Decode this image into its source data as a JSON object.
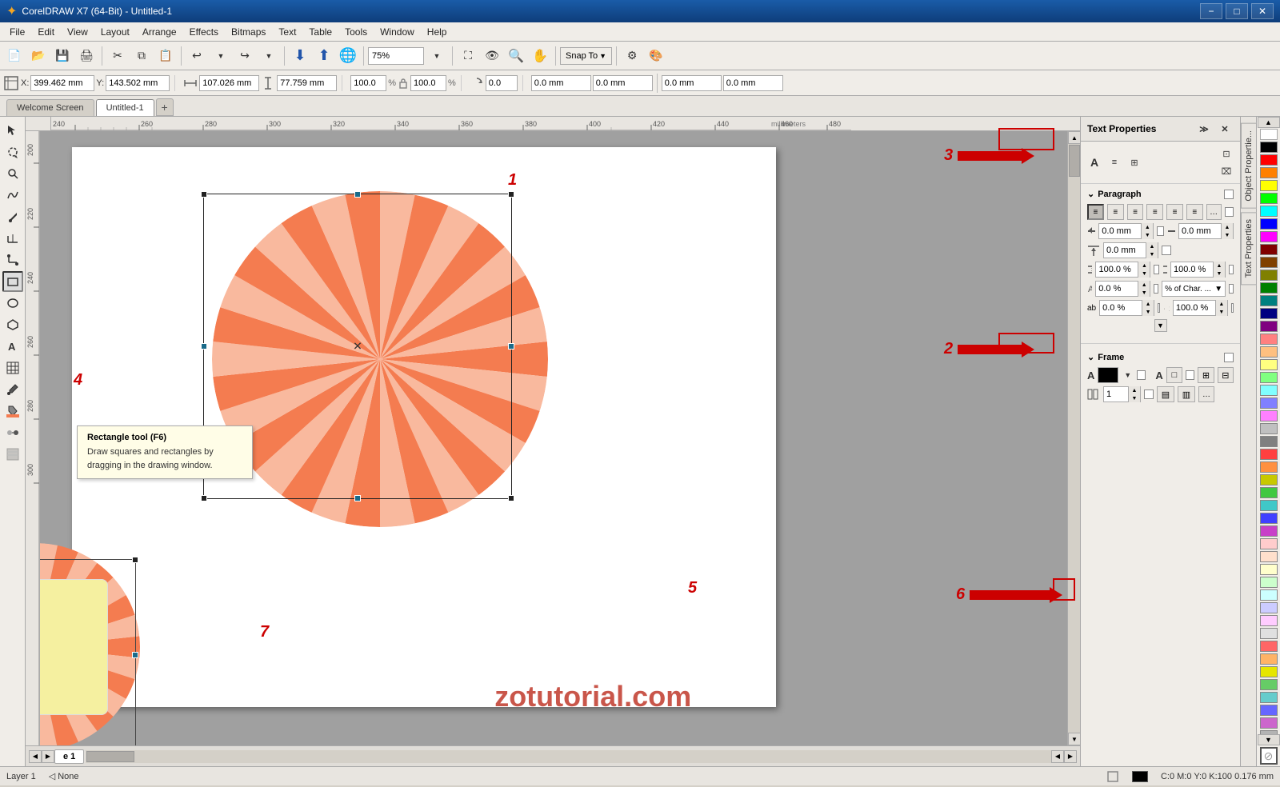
{
  "titlebar": {
    "title": "CorelDRAW X7 (64-Bit) - Untitled-1",
    "minimize": "−",
    "maximize": "□",
    "close": "✕"
  },
  "menubar": {
    "items": [
      "File",
      "Edit",
      "View",
      "Layout",
      "Arrange",
      "Effects",
      "Bitmaps",
      "Text",
      "Table",
      "Tools",
      "Window",
      "Help"
    ]
  },
  "toolbar": {
    "zoom_value": "75%",
    "snap_to": "Snap To"
  },
  "coords": {
    "x_label": "X:",
    "x_value": "399.462 mm",
    "y_label": "Y:",
    "y_value": "143.502 mm",
    "w_label": "",
    "w_value": "107.026 mm",
    "h_label": "",
    "h_value": "77.759 mm",
    "pct_w": "100.0",
    "pct_h": "100.0",
    "angle_value": "0.0",
    "pos_x": "0.0 mm",
    "pos_y": "0.0 mm",
    "pos2_x": "0.0 mm",
    "pos2_y": "0.0 mm"
  },
  "tabs": {
    "welcome": "Welcome Screen",
    "doc": "Untitled-1",
    "add": "+"
  },
  "text_properties": {
    "title": "Text Properties",
    "paragraph_label": "Paragraph",
    "frame_label": "Frame",
    "indent_left": "0.0 mm",
    "indent_right": "0.0 mm",
    "space_before": "0.0 mm",
    "line_spacing_pct": "100.0 %",
    "line_spacing2_pct": "100.0 %",
    "lang_spacing_pct": "0.0 %",
    "char_spacing_label": "% of Char. ...",
    "baseline_pct": "0.0 %",
    "hyphen_pct": "100.0 %",
    "frame_columns": "1",
    "frame_col_label": "1"
  },
  "annotations": {
    "n1": "1",
    "n2": "2",
    "n3": "3",
    "n4": "4",
    "n5": "5",
    "n6": "6",
    "n7": "7"
  },
  "tooltip": {
    "title": "Rectangle tool (F6)",
    "body": "Draw squares and rectangles by dragging in the drawing window."
  },
  "statusbar": {
    "layer": "Layer 1",
    "fill": "None",
    "color_info": "C:0 M:0 Y:0 K:100  0.176 mm"
  },
  "page_tab": {
    "label": "e 1"
  },
  "watermark": "zotutorial.com",
  "colors": {
    "sunburst_orange": "#f47c50",
    "sunburst_light": "#f9b99e",
    "yellow_rect": "#f5f0a0",
    "accent_red": "#cc0000"
  },
  "palette_colors": [
    "#ffffff",
    "#000000",
    "#ff0000",
    "#ff8000",
    "#ffff00",
    "#00ff00",
    "#00ffff",
    "#0000ff",
    "#ff00ff",
    "#800000",
    "#804000",
    "#808000",
    "#008000",
    "#008080",
    "#000080",
    "#800080",
    "#ff8080",
    "#ffc080",
    "#ffff80",
    "#80ff80",
    "#80ffff",
    "#8080ff",
    "#ff80ff",
    "#c0c0c0",
    "#808080",
    "#ff4040",
    "#ff9040",
    "#c8c800",
    "#40c840",
    "#40c8c8",
    "#4040ff",
    "#c840c8",
    "#ffcccc",
    "#ffe0cc",
    "#ffffcc",
    "#ccffcc",
    "#ccffff",
    "#ccccff",
    "#ffccff",
    "#e0e0e0",
    "#ff6666",
    "#ffb366",
    "#e6e600",
    "#66cc66",
    "#66cccc",
    "#6666ff",
    "#cc66cc",
    "#b3b3b3"
  ]
}
